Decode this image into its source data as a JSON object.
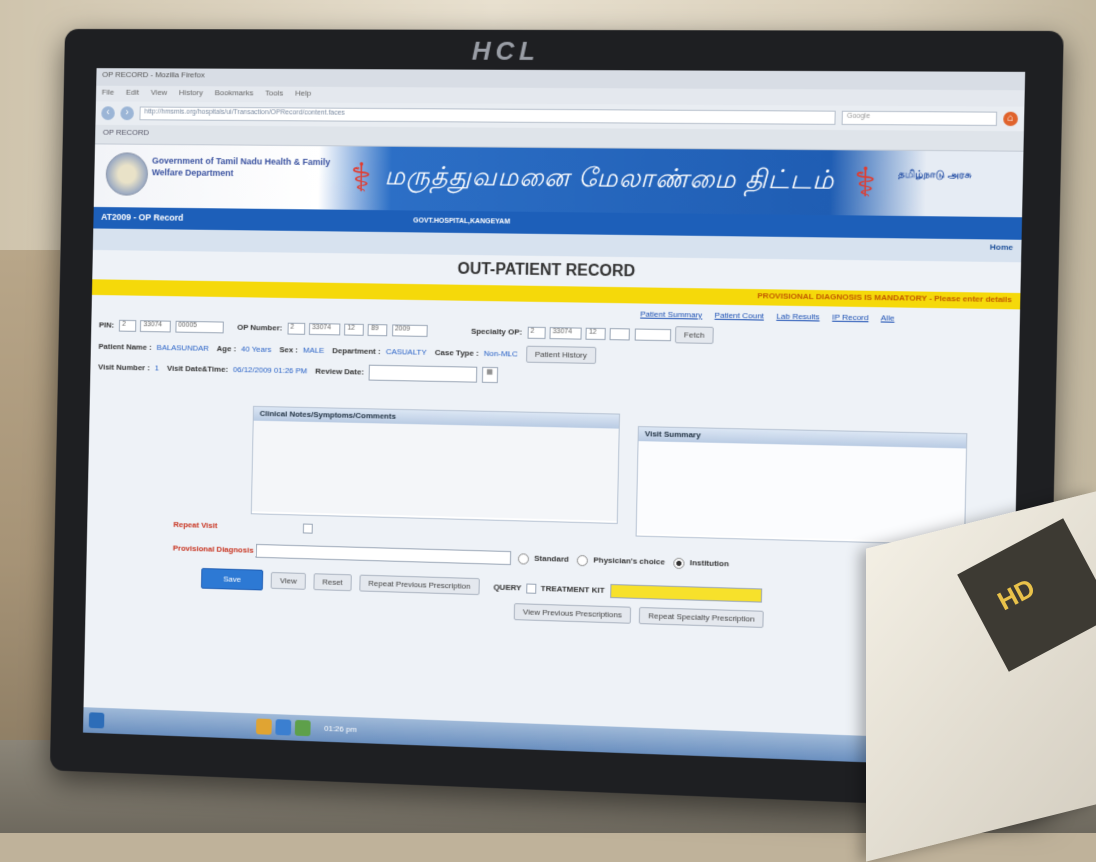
{
  "monitor": {
    "brand": "HCL"
  },
  "browser": {
    "window_title": "OP RECORD - Mozilla Firefox",
    "menu": [
      "File",
      "Edit",
      "View",
      "History",
      "Bookmarks",
      "Tools",
      "Help"
    ],
    "url": "http://hmsmis.org/hospitals/ui/Transaction/OPRecord/content.faces",
    "search_placeholder": "Google",
    "tab_label": "OP RECORD"
  },
  "app": {
    "department_name": "Government of Tamil Nadu Health & Family Welfare Department",
    "tamil_title": "மருத்துவமனை மேலாண்மை திட்டம்",
    "right_title": "தமிழ்நாடு அரசு",
    "screen_code": "AT2009 - OP Record",
    "hospital": "GOVT.HOSPITAL,KANGEYAM",
    "home_label": "Home",
    "page_title": "OUT-PATIENT RECORD",
    "warning": "PROVISIONAL DIAGNOSIS IS MANDATORY - Please enter details"
  },
  "form": {
    "pin_label": "PIN:",
    "pin_values": [
      "2",
      "33074",
      "00005"
    ],
    "op_number_label": "OP Number:",
    "op_number_values": [
      "2",
      "33074",
      "12",
      "89",
      "2009"
    ],
    "specialty_label": "Specialty OP:",
    "specialty_values": [
      "2",
      "33074",
      "12",
      "",
      ""
    ],
    "fetch_label": "Fetch",
    "links": [
      "Patient Summary",
      "Patient Count",
      "Lab Results",
      "IP Record",
      "Alle"
    ],
    "patient_name_label": "Patient Name :",
    "patient_name": "BALASUNDAR",
    "age_label": "Age :",
    "age": "40 Years",
    "sex_label": "Sex :",
    "sex": "MALE",
    "department_label": "Department :",
    "department": "CASUALTY",
    "case_type_label": "Case Type :",
    "case_type": "Non-MLC",
    "patient_history_label": "Patient History",
    "visit_number_label": "Visit Number :",
    "visit_number": "1",
    "visit_date_label": "Visit Date&Time:",
    "visit_date": "06/12/2009 01:26 PM",
    "review_date_label": "Review Date:",
    "clinical_panel_title": "Clinical Notes/Symptoms/Comments",
    "visit_summary_title": "Visit Summary",
    "repeat_visit_label": "Repeat Visit",
    "provisional_diagnosis_label": "Provisional Diagnosis",
    "query_label": "QUERY",
    "treatment_kit_label": "TREATMENT KIT",
    "radio_options": [
      "Standard",
      "Physician's choice",
      "Institution"
    ],
    "selected_radio": "Institution"
  },
  "buttons": {
    "save": "Save",
    "view": "View",
    "reset": "Reset",
    "repeat_prev": "Repeat Previous Prescription",
    "view_prev": "View Previous Prescriptions",
    "repeat_specialty": "Repeat Specialty Prescription"
  },
  "taskbar": {
    "clock": "01:26 pm"
  }
}
